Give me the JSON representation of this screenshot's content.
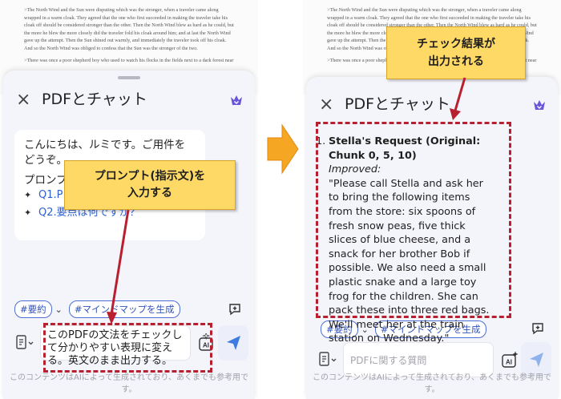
{
  "doc_text": {
    "para1": ">The North Wind and the Sun were disputing which was the stronger, when a traveler came along wrapped in a warm cloak. They agreed that the one who first succeeded in making the traveler take his cloak off should be considered stronger than the other. Then the North Wind blew as hard as he could, but the more he blew the more closely did the traveler fold his cloak around him; and at last the North Wind gave up the attempt. Then the Sun shined out warmly, and immediately the traveler took off his cloak. And so the North Wind was obliged to confess that the Sun was the stronger of the two.",
    "para2": ">There was once a poor shepherd boy who used to watch his flocks in the fields next to a dark forest near"
  },
  "panel": {
    "title": "PDFとチャット",
    "close_icon": "×",
    "chips": [
      "#要約",
      "#マインドマップを生成"
    ],
    "chevron": "⌄",
    "disclaimer": "このコンテンツはAIによって生成されており、あくまでも参考用です。"
  },
  "left": {
    "greeting": "こんにちは、ルミです。ご用件をどうぞ。",
    "prompt_heading": "プロンプ",
    "questions": [
      "Q1.P　　　　　　　　　　い。",
      "Q2.要点は何ですか？"
    ],
    "input_text": "このPDFの文法をチェックして分かりやすい表現に変える。英文のまま出力する。",
    "callout_lines": [
      "プロンプト(指示文)を",
      "入力する"
    ]
  },
  "right": {
    "answer": {
      "number": "1.",
      "title": "Stella's Request (Original: Chunk 0, 5, 10)",
      "improved_label": "Improved:",
      "text": "\"Please call Stella and ask her to bring the following items from the store: six spoons of fresh snow peas, five thick slices of blue cheese, and a snack for her brother Bob if possible. We also need a small plastic snake and a large toy frog for the children. She can pack these into three red bags. We'll meet her at the train station on Wednesday.\""
    },
    "input_placeholder": "PDFに関する質問",
    "callout_lines": [
      "チェック結果が",
      "出力される"
    ]
  },
  "icons": {
    "close": "close-icon",
    "crown": "crown-icon",
    "sparkle": "sparkle-icon",
    "new_chat": "new-chat-icon",
    "doc_tool": "document-list-icon",
    "ai": "ai-icon",
    "send": "send-icon",
    "arrow": "right-arrow-icon"
  },
  "colors": {
    "accent_blue": "#3353b8",
    "callout_yellow": "#ffd966",
    "annotation_red": "#b8202f",
    "arrow_orange": "#f5a623"
  }
}
